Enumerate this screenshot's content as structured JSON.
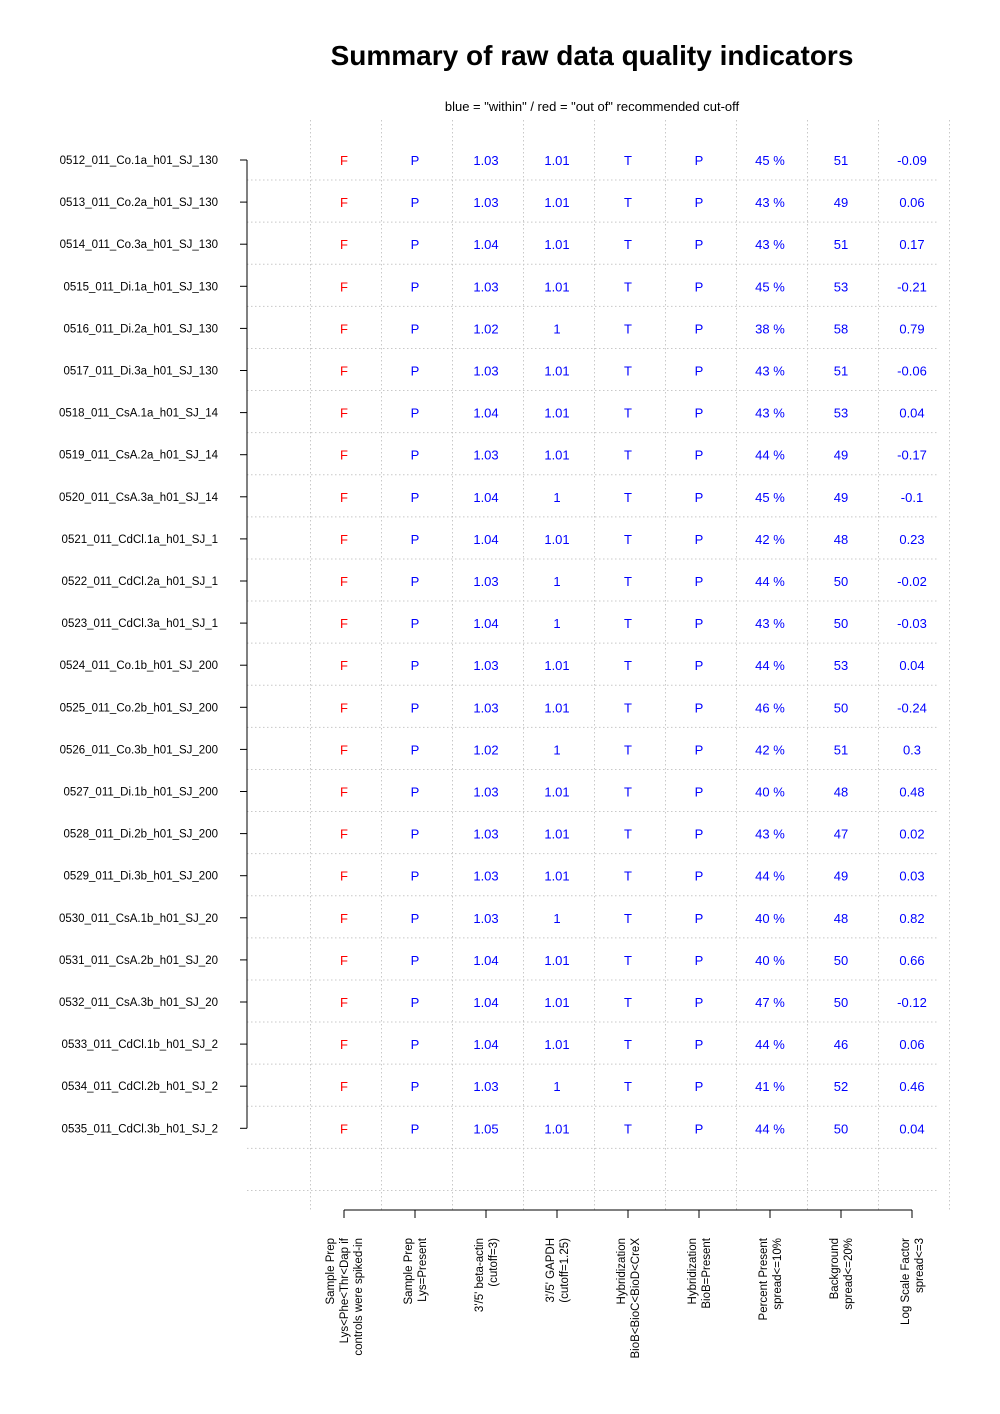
{
  "chart_data": {
    "type": "table",
    "title": "Summary of raw data quality indicators",
    "subtitle": "blue = \"within\" / red = \"out of\" recommended cut-off",
    "colors": {
      "within": "#0000ff",
      "out_of": "#ff0000"
    },
    "grid": true,
    "columns": [
      {
        "label_lines": [
          "Sample Prep",
          "Lys<Phe<Thr<Dap if",
          "controls were spiked-in"
        ]
      },
      {
        "label_lines": [
          "Sample Prep",
          "Lys=Present"
        ]
      },
      {
        "label_lines": [
          "3'/5' beta-actin",
          "(cutoff=3)"
        ]
      },
      {
        "label_lines": [
          "3'/5' GAPDH",
          "(cutoff=1.25)"
        ]
      },
      {
        "label_lines": [
          "Hybridization",
          "BioB<BioC<BioD<CreX"
        ]
      },
      {
        "label_lines": [
          "Hybridization",
          "BioB=Present"
        ]
      },
      {
        "label_lines": [
          "Percent Present",
          "spread<=10%"
        ]
      },
      {
        "label_lines": [
          "Background",
          "spread<=20%"
        ]
      },
      {
        "label_lines": [
          "Log Scale Factor",
          "spread<=3"
        ]
      }
    ],
    "rows": [
      {
        "label": "0512_011_Co.1a_h01_SJ_130",
        "values": [
          "F",
          "P",
          "1.03",
          "1.01",
          "T",
          "P",
          "45 %",
          "51",
          "-0.09"
        ]
      },
      {
        "label": "0513_011_Co.2a_h01_SJ_130",
        "values": [
          "F",
          "P",
          "1.03",
          "1.01",
          "T",
          "P",
          "43 %",
          "49",
          "0.06"
        ]
      },
      {
        "label": "0514_011_Co.3a_h01_SJ_130",
        "values": [
          "F",
          "P",
          "1.04",
          "1.01",
          "T",
          "P",
          "43 %",
          "51",
          "0.17"
        ]
      },
      {
        "label": "0515_011_Di.1a_h01_SJ_130",
        "values": [
          "F",
          "P",
          "1.03",
          "1.01",
          "T",
          "P",
          "45 %",
          "53",
          "-0.21"
        ]
      },
      {
        "label": "0516_011_Di.2a_h01_SJ_130",
        "values": [
          "F",
          "P",
          "1.02",
          "1",
          "T",
          "P",
          "38 %",
          "58",
          "0.79"
        ]
      },
      {
        "label": "0517_011_Di.3a_h01_SJ_130",
        "values": [
          "F",
          "P",
          "1.03",
          "1.01",
          "T",
          "P",
          "43 %",
          "51",
          "-0.06"
        ]
      },
      {
        "label": "0518_011_CsA.1a_h01_SJ_14",
        "values": [
          "F",
          "P",
          "1.04",
          "1.01",
          "T",
          "P",
          "43 %",
          "53",
          "0.04"
        ]
      },
      {
        "label": "0519_011_CsA.2a_h01_SJ_14",
        "values": [
          "F",
          "P",
          "1.03",
          "1.01",
          "T",
          "P",
          "44 %",
          "49",
          "-0.17"
        ]
      },
      {
        "label": "0520_011_CsA.3a_h01_SJ_14",
        "values": [
          "F",
          "P",
          "1.04",
          "1",
          "T",
          "P",
          "45 %",
          "49",
          "-0.1"
        ]
      },
      {
        "label": "0521_011_CdCl.1a_h01_SJ_1",
        "values": [
          "F",
          "P",
          "1.04",
          "1.01",
          "T",
          "P",
          "42 %",
          "48",
          "0.23"
        ]
      },
      {
        "label": "0522_011_CdCl.2a_h01_SJ_1",
        "values": [
          "F",
          "P",
          "1.03",
          "1",
          "T",
          "P",
          "44 %",
          "50",
          "-0.02"
        ]
      },
      {
        "label": "0523_011_CdCl.3a_h01_SJ_1",
        "values": [
          "F",
          "P",
          "1.04",
          "1",
          "T",
          "P",
          "43 %",
          "50",
          "-0.03"
        ]
      },
      {
        "label": "0524_011_Co.1b_h01_SJ_200",
        "values": [
          "F",
          "P",
          "1.03",
          "1.01",
          "T",
          "P",
          "44 %",
          "53",
          "0.04"
        ]
      },
      {
        "label": "0525_011_Co.2b_h01_SJ_200",
        "values": [
          "F",
          "P",
          "1.03",
          "1.01",
          "T",
          "P",
          "46 %",
          "50",
          "-0.24"
        ]
      },
      {
        "label": "0526_011_Co.3b_h01_SJ_200",
        "values": [
          "F",
          "P",
          "1.02",
          "1",
          "T",
          "P",
          "42 %",
          "51",
          "0.3"
        ]
      },
      {
        "label": "0527_011_Di.1b_h01_SJ_200",
        "values": [
          "F",
          "P",
          "1.03",
          "1.01",
          "T",
          "P",
          "40 %",
          "48",
          "0.48"
        ]
      },
      {
        "label": "0528_011_Di.2b_h01_SJ_200",
        "values": [
          "F",
          "P",
          "1.03",
          "1.01",
          "T",
          "P",
          "43 %",
          "47",
          "0.02"
        ]
      },
      {
        "label": "0529_011_Di.3b_h01_SJ_200",
        "values": [
          "F",
          "P",
          "1.03",
          "1.01",
          "T",
          "P",
          "44 %",
          "49",
          "0.03"
        ]
      },
      {
        "label": "0530_011_CsA.1b_h01_SJ_20",
        "values": [
          "F",
          "P",
          "1.03",
          "1",
          "T",
          "P",
          "40 %",
          "48",
          "0.82"
        ]
      },
      {
        "label": "0531_011_CsA.2b_h01_SJ_20",
        "values": [
          "F",
          "P",
          "1.04",
          "1.01",
          "T",
          "P",
          "40 %",
          "50",
          "0.66"
        ]
      },
      {
        "label": "0532_011_CsA.3b_h01_SJ_20",
        "values": [
          "F",
          "P",
          "1.04",
          "1.01",
          "T",
          "P",
          "47 %",
          "50",
          "-0.12"
        ]
      },
      {
        "label": "0533_011_CdCl.1b_h01_SJ_2",
        "values": [
          "F",
          "P",
          "1.04",
          "1.01",
          "T",
          "P",
          "44 %",
          "46",
          "0.06"
        ]
      },
      {
        "label": "0534_011_CdCl.2b_h01_SJ_2",
        "values": [
          "F",
          "P",
          "1.03",
          "1",
          "T",
          "P",
          "41 %",
          "52",
          "0.46"
        ]
      },
      {
        "label": "0535_011_CdCl.3b_h01_SJ_2",
        "values": [
          "F",
          "P",
          "1.05",
          "1.01",
          "T",
          "P",
          "44 %",
          "50",
          "0.04"
        ]
      }
    ],
    "out_of_cutoff_columns": [
      0
    ]
  }
}
